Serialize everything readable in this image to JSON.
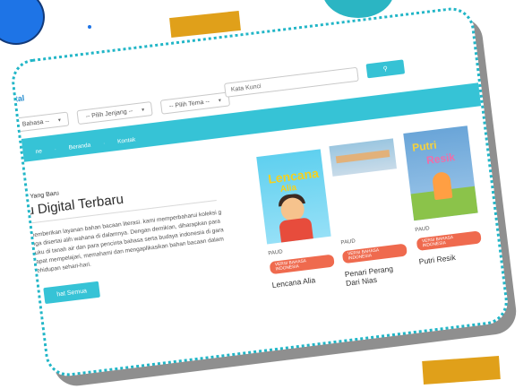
{
  "header": {
    "site_name": "ital"
  },
  "filters": [
    {
      "label": "Bahasa --"
    },
    {
      "label": "-- Pilih Jenjang --"
    },
    {
      "label": "-- Pilih Tema --"
    }
  ],
  "search": {
    "placeholder": "Kata Kunci",
    "button_icon": "search-icon"
  },
  "nav": {
    "items": [
      "ne",
      "Beranda",
      "Kontak"
    ]
  },
  "section": {
    "eyebrow": "n Yang Baru",
    "title": "u Digital Terbaru",
    "description": "memberikan layanan bahan bacaan literasi. kami memperbaharui koleksi g juga disertai alih wahana di dalamnya. Dengan demikian, diharapkan para buku di tanah air dan para pencinta bahasa serta budaya indonesia di gara dapat mempelajari, memahami dan mengaplikasikan bahan bacaan dalam kehidupan sehari-hari.",
    "see_all": "hat Semua"
  },
  "books": [
    {
      "category": "PAUD",
      "badge": "VERSI BAHASA INDONESIA",
      "title": "Lencana Alia",
      "cover_text_1": "Lencana",
      "cover_text_2": "Alia"
    },
    {
      "category": "PAUD",
      "badge": "VERSI BAHASA INDONESIA",
      "title": "Penari Perang Dari Nias"
    },
    {
      "category": "PAUD",
      "badge": "VERSI BAHASA INDONESIA",
      "title": "Putri Resik",
      "cover_text_1": "Putri",
      "cover_text_2": "Resik"
    }
  ],
  "colors": {
    "accent": "#36c3d6",
    "badge": "#ef6a4e",
    "tape": "#E0A01A",
    "blob": "#1E74E6"
  }
}
